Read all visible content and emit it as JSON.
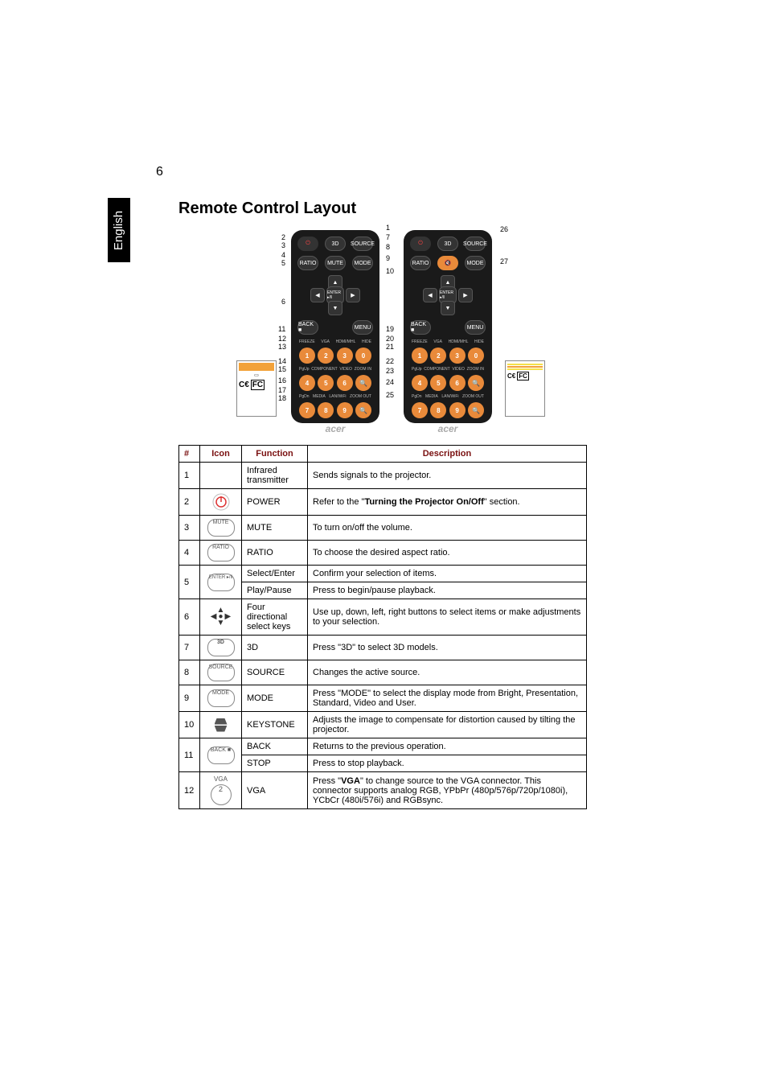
{
  "page_number": "6",
  "side_tab": "English",
  "title": "Remote Control Layout",
  "remote_brand": "acer",
  "remote_buttons": {
    "power": "⏻",
    "threeD": "3D",
    "source": "SOURCE",
    "ratio": "RATIO",
    "mute": "MUTE",
    "mode": "MODE",
    "enter": "ENTER ▸/‖",
    "back": "BACK ■",
    "menu": "MENU"
  },
  "remote_num_labels_row1": [
    "FREEZE",
    "VGA",
    "HDMI/MHL",
    "HIDE"
  ],
  "remote_num_labels_row2": [
    "PgUp",
    "COMPONENT",
    "VIDEO",
    "ZOOM IN"
  ],
  "remote_num_labels_row3": [
    "PgDn",
    "MEDIA",
    "LAN/WiFi",
    "ZOOM OUT"
  ],
  "remote_nums_row1": [
    "1",
    "2",
    "3",
    "0"
  ],
  "remote_nums_row2": [
    "4",
    "5",
    "6",
    "🔍"
  ],
  "remote_nums_row3": [
    "7",
    "8",
    "9",
    "🔍"
  ],
  "callouts_left": {
    "c1": "1",
    "c2": "2",
    "c3": "3",
    "c4": "4",
    "c5": "5",
    "c6": "6",
    "c11": "11",
    "c12": "12",
    "c13": "13",
    "c14": "14",
    "c15": "15",
    "c16": "16",
    "c17": "17",
    "c18": "18"
  },
  "callouts_right": {
    "c7": "7",
    "c8": "8",
    "c9": "9",
    "c10": "10",
    "c19": "19",
    "c20": "20",
    "c21": "21",
    "c22": "22",
    "c23": "23",
    "c24": "24",
    "c25": "25",
    "c26": "26",
    "c27": "27"
  },
  "table": {
    "headers": {
      "num": "#",
      "icon": "Icon",
      "func": "Function",
      "desc": "Description"
    },
    "rows": [
      {
        "num": "1",
        "icon": "",
        "func": "Infrared transmitter",
        "desc": "Sends signals to the projector."
      },
      {
        "num": "2",
        "icon": "power",
        "func": "POWER",
        "desc_pre": "Refer to the \"",
        "desc_bold": "Turning the Projector On/Off",
        "desc_post": "\" section."
      },
      {
        "num": "3",
        "icon": "mute",
        "func": "MUTE",
        "desc": "To turn on/off the volume."
      },
      {
        "num": "4",
        "icon": "ratio",
        "func": "RATIO",
        "desc": "To choose the desired aspect ratio."
      },
      {
        "num": "5",
        "icon": "enter",
        "func1": "Select/Enter",
        "desc1": "Confirm your selection of items.",
        "func2": "Play/Pause",
        "desc2": "Press to begin/pause playback."
      },
      {
        "num": "6",
        "icon": "dpad",
        "func": "Four directional select keys",
        "desc": "Use up, down, left, right buttons to select items or make adjustments to your selection."
      },
      {
        "num": "7",
        "icon": "3d",
        "func": "3D",
        "desc": "Press \"3D\" to select 3D models."
      },
      {
        "num": "8",
        "icon": "source",
        "func": "SOURCE",
        "desc": "Changes the active source."
      },
      {
        "num": "9",
        "icon": "mode",
        "func": "MODE",
        "desc": "Press \"MODE\" to select the display mode from Bright, Presentation, Standard, Video and User."
      },
      {
        "num": "10",
        "icon": "keystone",
        "func": "KEYSTONE",
        "desc": "Adjusts the image to compensate for distortion caused by tilting the projector."
      },
      {
        "num": "11",
        "icon": "back",
        "func1": "BACK",
        "desc1": "Returns to the previous operation.",
        "func2": "STOP",
        "desc2": "Press to stop playback."
      },
      {
        "num": "12",
        "icon": "vga",
        "func": "VGA",
        "desc_pre": "Press \"",
        "desc_bold": "VGA",
        "desc_post": "\" to change source to the VGA connector. This connector supports analog RGB, YPbPr (480p/576p/720p/1080i), YCbCr (480i/576i) and RGBsync."
      }
    ]
  },
  "icon_text": {
    "mute": "MUTE",
    "ratio": "RATIO",
    "enter": "ENTER ▸/‖",
    "threeD": "3D",
    "source": "SOURCE",
    "mode": "MODE",
    "back": "BACK ■",
    "vga": "VGA",
    "vga_num": "2"
  }
}
